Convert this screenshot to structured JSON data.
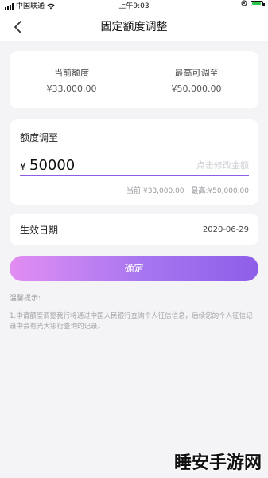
{
  "status_bar": {
    "carrier": "中国联通",
    "time": "上午9:03"
  },
  "nav": {
    "title": "固定额度调整",
    "icons": {
      "back": "chevron-left-icon"
    }
  },
  "limits": {
    "current_label": "当前额度",
    "current_value": "¥33,000.00",
    "max_label": "最高可调至",
    "max_value": "¥50,000.00"
  },
  "adjust": {
    "title": "额度调至",
    "currency": "¥",
    "amount_value": "50000",
    "amount_placeholder": "点击修改金额",
    "hint_current": "当前:¥33,000.00",
    "hint_max": "最高:¥50,000.00"
  },
  "effective_date": {
    "label": "生效日期",
    "value": "2020-06-29"
  },
  "confirm_button": {
    "label": "确定"
  },
  "tips": {
    "title": "温馨提示:",
    "text": "1.申请额度调整我行将通过中国人民银行查询个人征信信息，后续您的个人征信记录中会有光大银行查询的记录。"
  },
  "watermark": {
    "text": "睡安手游网"
  },
  "colors": {
    "accent": "#8c5ee6",
    "button_gradient_start": "#e28df2",
    "button_gradient_end": "#8e5ee8",
    "background": "#f4f4f6"
  }
}
